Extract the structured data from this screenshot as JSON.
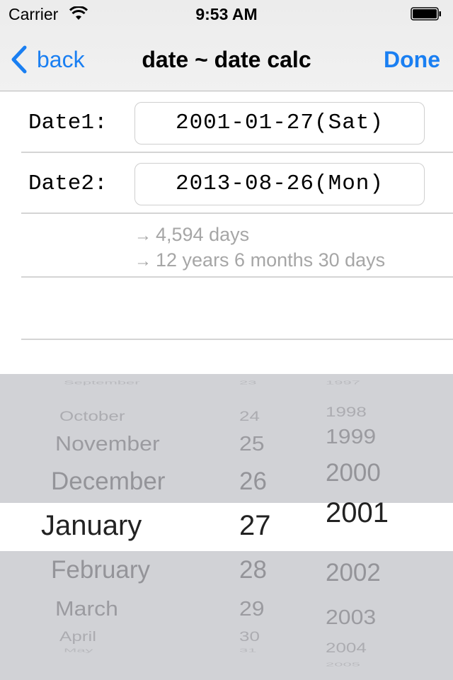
{
  "status_bar": {
    "carrier": "Carrier",
    "wifi_icon": "wifi-icon",
    "time": "9:53 AM",
    "battery_icon": "battery-full-icon"
  },
  "nav": {
    "back_label": "back",
    "back_icon": "chevron-left-icon",
    "title": "date ~ date calc",
    "done_label": "Done",
    "accent_color": "#1a7ff2"
  },
  "form": {
    "date1_label": "Date1:",
    "date1_value": "2001-01-27(Sat)",
    "date2_label": "Date2:",
    "date2_value": "2013-08-26(Mon)",
    "result_days": "4,594 days",
    "result_ymd": "12 years 6 months 30 days",
    "arrow": "→"
  },
  "picker": {
    "months": [
      "September",
      "October",
      "November",
      "December",
      "January",
      "February",
      "March",
      "April",
      "May"
    ],
    "days": [
      "23",
      "24",
      "25",
      "26",
      "27",
      "28",
      "29",
      "30",
      "31"
    ],
    "years": [
      "1997",
      "1998",
      "1999",
      "2000",
      "2001",
      "2002",
      "2003",
      "2004",
      "2005"
    ],
    "selected": {
      "month": "January",
      "day": "27",
      "year": "2001"
    }
  }
}
